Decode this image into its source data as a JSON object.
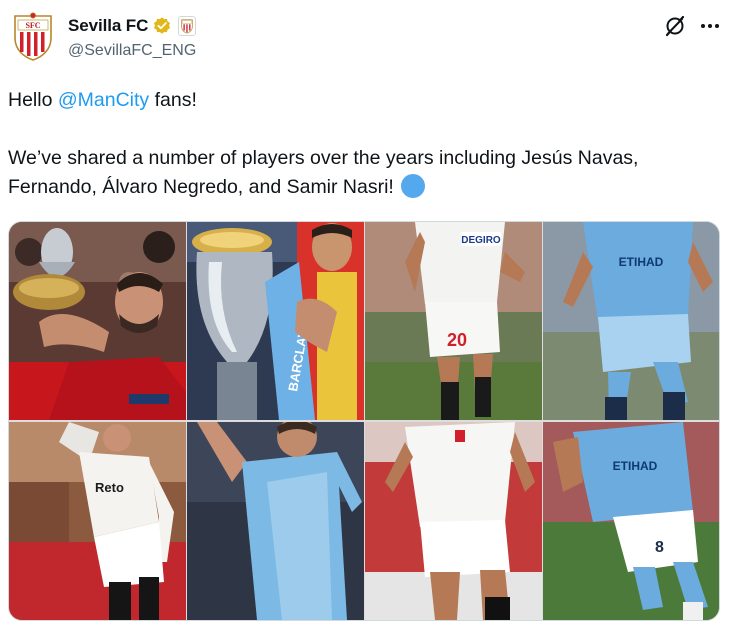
{
  "tweet": {
    "author": {
      "display_name": "Sevilla FC",
      "handle": "@SevillaFC_ENG",
      "verified": true,
      "avatar_icon": "sevilla-crest-icon",
      "affiliate_icon": "sevilla-crest-badge-icon"
    },
    "text": {
      "greeting_prefix": "Hello ",
      "mention": "@ManCity",
      "greeting_suffix": " fans!",
      "body": "We’ve shared a number of players over the years including Jesús Navas, Fernando, Álvaro Negredo, and Samir Nasri!",
      "emoji_icon": "blue-circle-icon"
    },
    "actions": {
      "grok_icon": "grok-icon",
      "more_icon": "more-icon"
    },
    "media": {
      "tiles": [
        {
          "name": "photo-1",
          "kit": "trophy-celebration"
        },
        {
          "name": "photo-2",
          "kit": "premier-league-trophy",
          "banner_text": "BARCLAYS"
        },
        {
          "name": "photo-3",
          "kit": "sevilla-white",
          "sponsor": "DEGIRO",
          "number": "20"
        },
        {
          "name": "photo-4",
          "kit": "city-blue",
          "sponsor": "ETIHAD"
        },
        {
          "name": "photo-5",
          "kit": "sevilla-white",
          "sponsor": "Reto"
        },
        {
          "name": "photo-6",
          "kit": "city-blue"
        },
        {
          "name": "photo-7",
          "kit": "sevilla-white"
        },
        {
          "name": "photo-8",
          "kit": "city-blue",
          "sponsor": "ETIHAD",
          "number": "8"
        }
      ]
    }
  },
  "colors": {
    "link": "#1d9bf0",
    "text": "#0f1419",
    "secondary": "#536471",
    "verified_gold": "#e2b719",
    "sevilla_red": "#d11f2b",
    "city_blue": "#6cabdd"
  }
}
